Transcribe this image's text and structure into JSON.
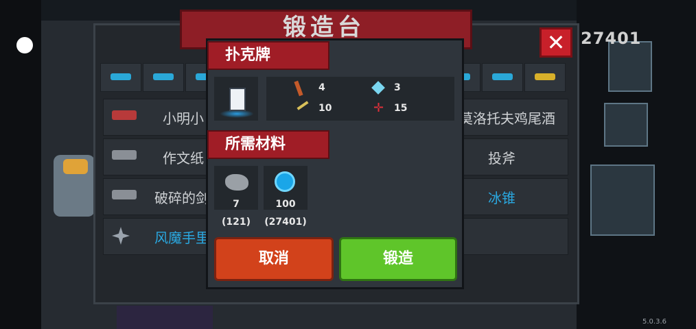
{
  "forge": {
    "title": "锻造台",
    "close_label": "✕",
    "coins": "27401",
    "tabs": [
      "pistol",
      "smg",
      "rifle",
      "blade",
      "blade2",
      "fish",
      "crown"
    ],
    "rows": [
      {
        "left_name": "小明小",
        "right_name": "莫洛托夫鸡尾酒"
      },
      {
        "left_name": "作文纸",
        "right_name": "投斧"
      },
      {
        "left_name": "破碎的剑",
        "right_name": "冰锥"
      },
      {
        "left_name": "风魔手里",
        "right_name": ""
      }
    ]
  },
  "popup": {
    "item_name": "扑克牌",
    "stats": {
      "attack": "4",
      "energy": "3",
      "crit": "10",
      "spread": "15"
    },
    "materials_title": "所需材料",
    "materials": [
      {
        "icon": "ore-icon",
        "required": "7",
        "owned": "(121)"
      },
      {
        "icon": "gem-icon",
        "required": "100",
        "owned": "(27401)"
      }
    ],
    "cancel_label": "取消",
    "forge_label": "锻造"
  },
  "version": "5.0.3.6",
  "colors": {
    "ribbon": "#a01d26",
    "cancel": "#d2421b",
    "confirm": "#5fc52a",
    "close": "#c8202a"
  }
}
